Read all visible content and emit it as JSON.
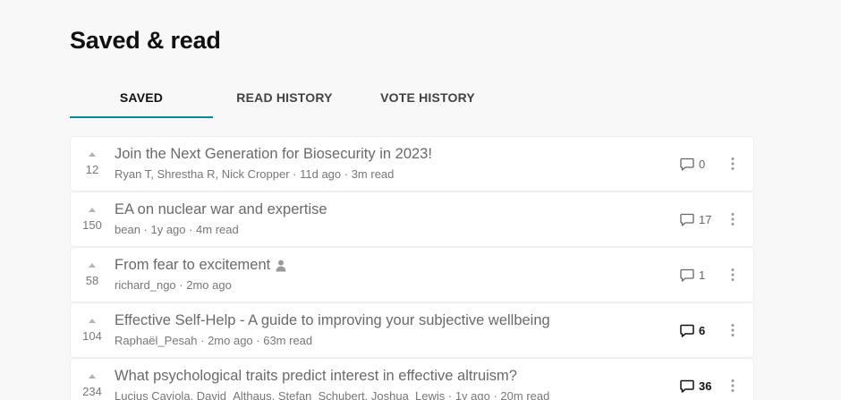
{
  "page": {
    "title": "Saved & read"
  },
  "tabs": [
    {
      "label": "SAVED",
      "active": true
    },
    {
      "label": "READ HISTORY",
      "active": false
    },
    {
      "label": "VOTE HISTORY",
      "active": false
    }
  ],
  "colors": {
    "accent": "#0c869b",
    "title_text": "#6a6a6a",
    "meta_text": "#777777"
  },
  "icons": {
    "upvote": "triangle-up-icon",
    "comments": "comment-bubble-icon",
    "more": "vertical-ellipsis-icon",
    "person": "person-icon"
  },
  "posts": [
    {
      "karma": "12",
      "title": "Join the Next Generation for Biosecurity in 2023!",
      "meta": "Ryan T, Shrestha R, Nick Cropper · 11d ago · 3m read",
      "comments": "0",
      "comments_bold": false,
      "personal": false
    },
    {
      "karma": "150",
      "title": "EA on nuclear war and expertise",
      "meta": "bean · 1y ago · 4m read",
      "comments": "17",
      "comments_bold": false,
      "personal": false
    },
    {
      "karma": "58",
      "title": "From fear to excitement",
      "meta": "richard_ngo · 2mo ago",
      "comments": "1",
      "comments_bold": false,
      "personal": true
    },
    {
      "karma": "104",
      "title": "Effective Self-Help - A guide to improving your subjective wellbeing",
      "meta": "Raphaël_Pesah · 2mo ago · 63m read",
      "comments": "6",
      "comments_bold": true,
      "personal": false
    },
    {
      "karma": "234",
      "title": "What psychological traits predict interest in effective altruism?",
      "meta": "Lucius Caviola, David_Althaus, Stefan_Schubert, Joshua_Lewis · 1y ago · 20m read",
      "comments": "36",
      "comments_bold": true,
      "personal": false
    }
  ]
}
